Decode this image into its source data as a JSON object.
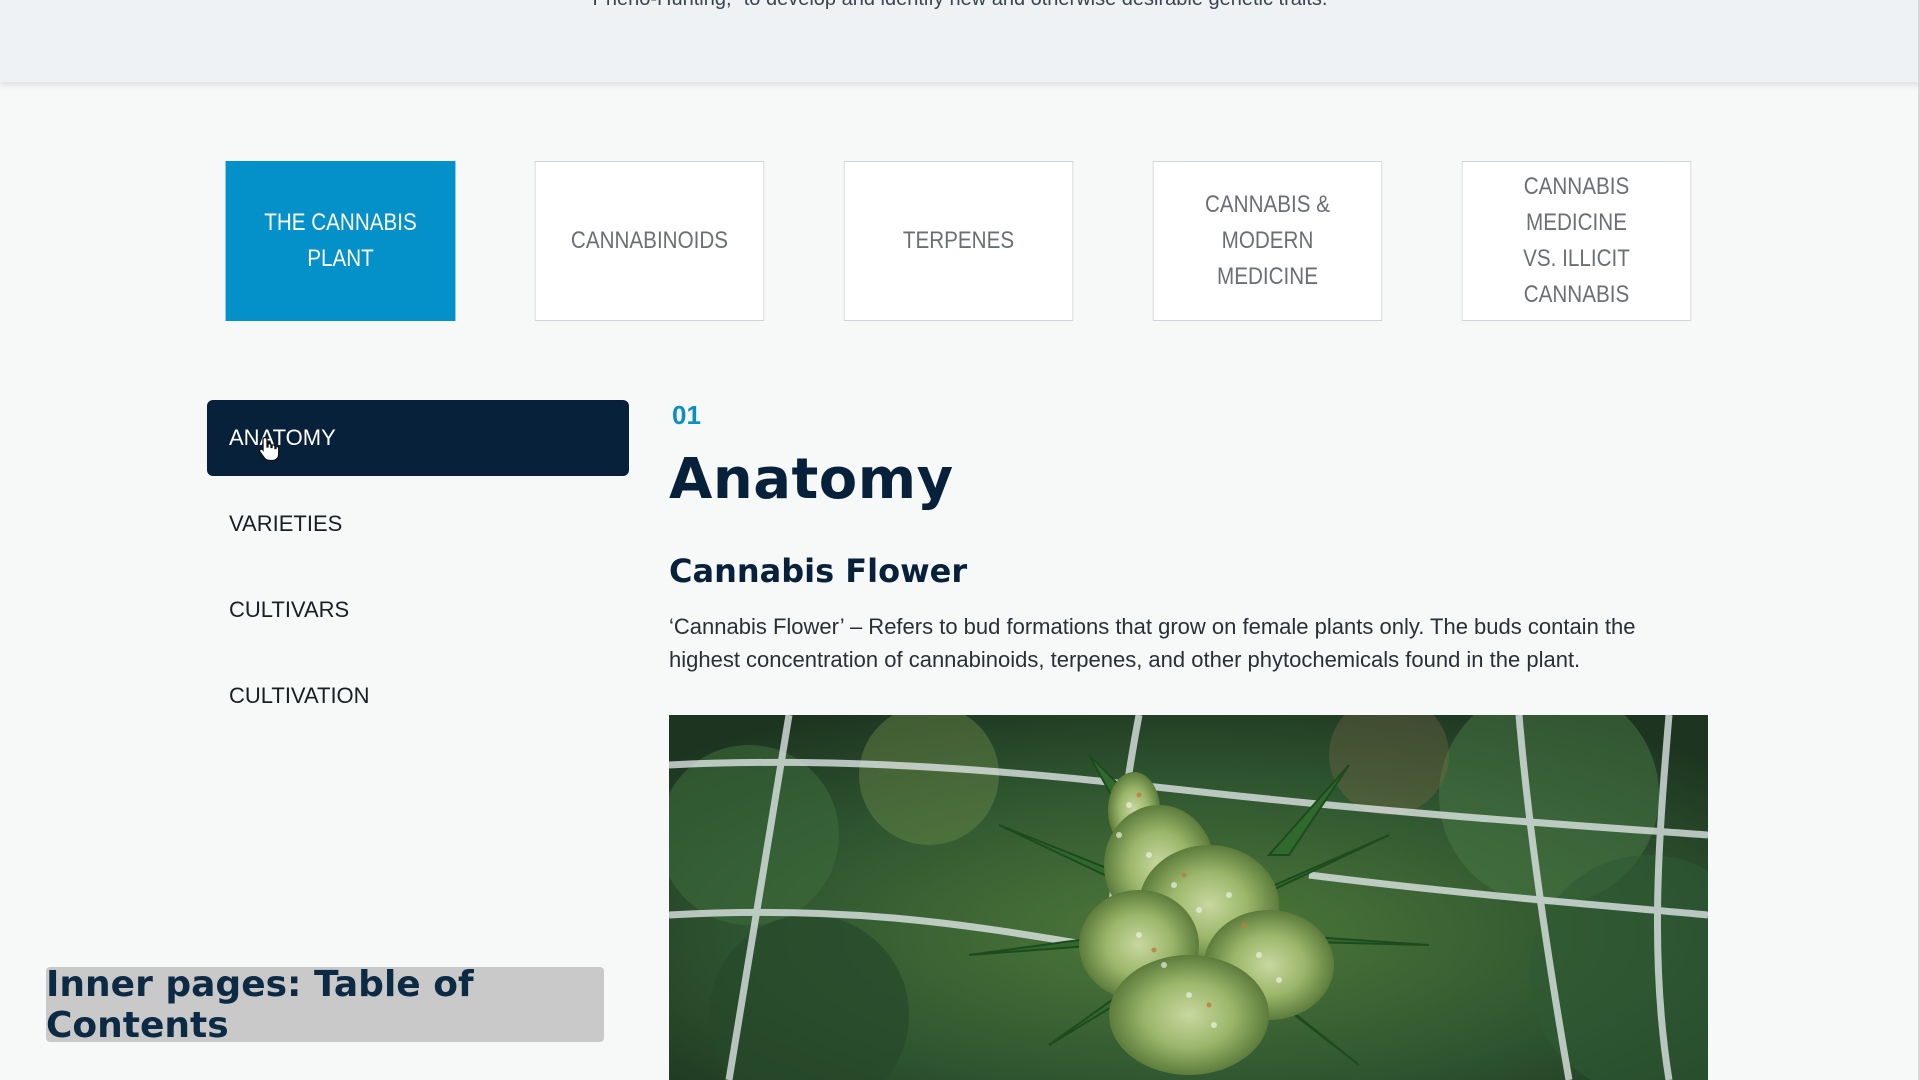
{
  "intro_text": "Pheno-Hunting,” to develop and identify new and otherwise desirable genetic traits.",
  "tabs": [
    {
      "label": "THE CANNABIS PLANT",
      "active": true
    },
    {
      "label": "CANNABINOIDS",
      "active": false
    },
    {
      "label": "TERPENES",
      "active": false
    },
    {
      "label": "CANNABIS & MODERN\nMEDICINE",
      "active": false
    },
    {
      "label": "CANNABIS MEDICINE\nVS. ILLICIT CANNABIS",
      "active": false
    }
  ],
  "side_nav": [
    {
      "label": "ANATOMY",
      "active": true
    },
    {
      "label": "VARIETIES",
      "active": false
    },
    {
      "label": "CULTIVARS",
      "active": false
    },
    {
      "label": "CULTIVATION",
      "active": false
    }
  ],
  "content": {
    "section_number": "01",
    "section_title": "Anatomy",
    "subtitle": "Cannabis Flower",
    "body": "‘Cannabis Flower’ – Refers to bud formations that grow on female plants only. The buds contain the highest concentration of cannabinoids, terpenes, and other phytochemicals found in the plant."
  },
  "caption": "Inner pages: Table of Contents",
  "colors": {
    "accent_blue": "#0490c8",
    "navy": "#08213a",
    "caption_bg": "#c9c9c9"
  },
  "icons": {
    "cursor": "hand-pointer-icon"
  }
}
